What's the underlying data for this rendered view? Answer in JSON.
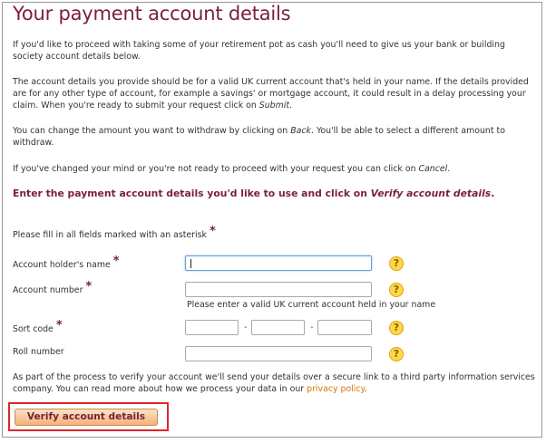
{
  "page": {
    "title": "Your payment account details",
    "intro": "If you'd like to proceed with taking some of your retirement pot as cash you'll need to give us your bank or building society account details below.",
    "account_info_1": "The account details you provide should be for a valid UK current account that's held in your name. If the details provided are for any other type of account, for example a savings' or mortgage account, it could result in a delay processing your claim. When you're ready to submit your request click on ",
    "account_info_submit": "Submit",
    "account_info_end": ".",
    "change_amount_1": "You can change the amount you want to withdraw by clicking on ",
    "change_amount_back": "Back",
    "change_amount_2": ". You'll be able to select a different amount to withdraw.",
    "changed_mind_1": "If you've changed your mind or you're not ready to proceed with your request you can click on ",
    "changed_mind_cancel": "Cancel",
    "changed_mind_end": ".",
    "instruction_1": "Enter the payment account details you'd like to use and click on ",
    "instruction_verify": "Verify account details",
    "instruction_end": ".",
    "required_note": "Please fill in all fields marked with an asterisk",
    "asterisk": "*"
  },
  "form": {
    "account_holder_label": "Account holder's name",
    "account_holder_value": "",
    "account_number_label": "Account number",
    "account_number_value": "",
    "account_number_hint": "Please enter a valid UK current account held in your name",
    "sort_code_label": "Sort code",
    "sort_code_values": [
      "",
      "",
      ""
    ],
    "sort_code_separator": "-",
    "roll_number_label": "Roll number",
    "roll_number_value": "",
    "help_glyph": "?"
  },
  "footer": {
    "privacy_text_1": "As part of the process to verify your account we'll send your details over a secure link to a third party information services company. You can read more about how we process your data in our ",
    "privacy_link": "privacy policy",
    "privacy_text_end": ".",
    "verify_button": "Verify account details"
  },
  "colors": {
    "heading": "#7a1e3c",
    "link": "#d4780a",
    "help_icon": "#ffd84a",
    "highlight_outline": "#e0262a"
  }
}
